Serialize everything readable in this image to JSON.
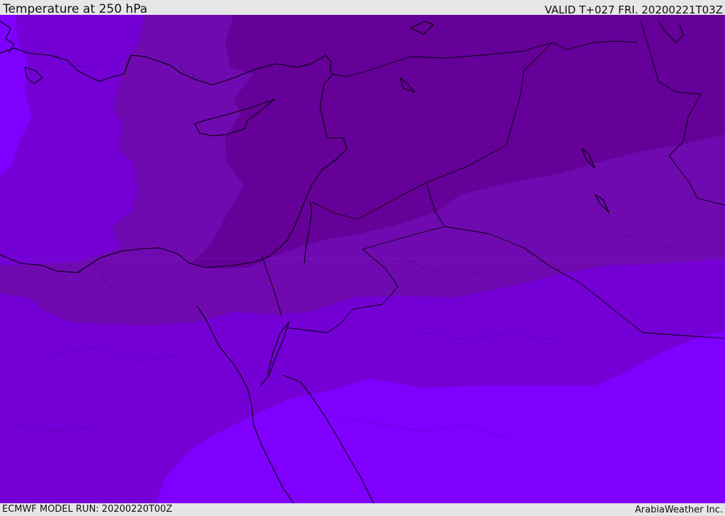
{
  "header": {
    "title": "Temperature at 250 hPa",
    "valid": "VALID T+027 FRI. 20200221T03Z"
  },
  "footer": {
    "model_run": "ECMWF MODEL RUN: 20200220T00Z",
    "credit": "ArabiaWeather Inc."
  },
  "colors": {
    "coldest_band": "#650099",
    "cold_band": "#6f0ab0",
    "mid_band": "#7400d6",
    "warm_band": "#7f00ff",
    "land_borders": "#000000",
    "chrome": "#e6e6e6"
  }
}
